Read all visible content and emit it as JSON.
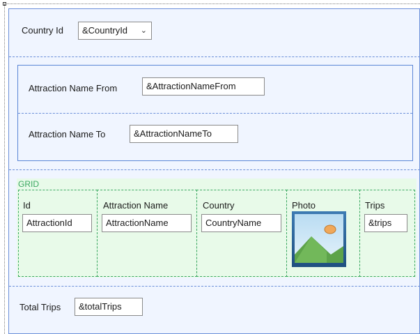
{
  "form": {
    "country": {
      "label": "Country Id",
      "value": "&CountryId"
    },
    "range_from": {
      "label": "Attraction Name From",
      "value": "&AttractionNameFrom"
    },
    "range_to": {
      "label": "Attraction Name To",
      "value": "&AttractionNameTo"
    },
    "grid": {
      "title": "GRID",
      "columns": [
        {
          "header": "Id",
          "value": "AttractionId"
        },
        {
          "header": "Attraction Name",
          "value": "AttractionName"
        },
        {
          "header": "Country",
          "value": "CountryName"
        },
        {
          "header": "Photo",
          "value": ""
        },
        {
          "header": "Trips",
          "value": "&trips"
        }
      ]
    },
    "totals": {
      "label": "Total Trips",
      "value": "&totalTrips"
    }
  },
  "colors": {
    "outer_border": "#6b8fd9",
    "section_fill": "#f0f5ff",
    "group_border": "#5b86d6",
    "grid_fill": "#e8fae9",
    "grid_border": "#3aa860",
    "grid_title": "#3aa860"
  }
}
